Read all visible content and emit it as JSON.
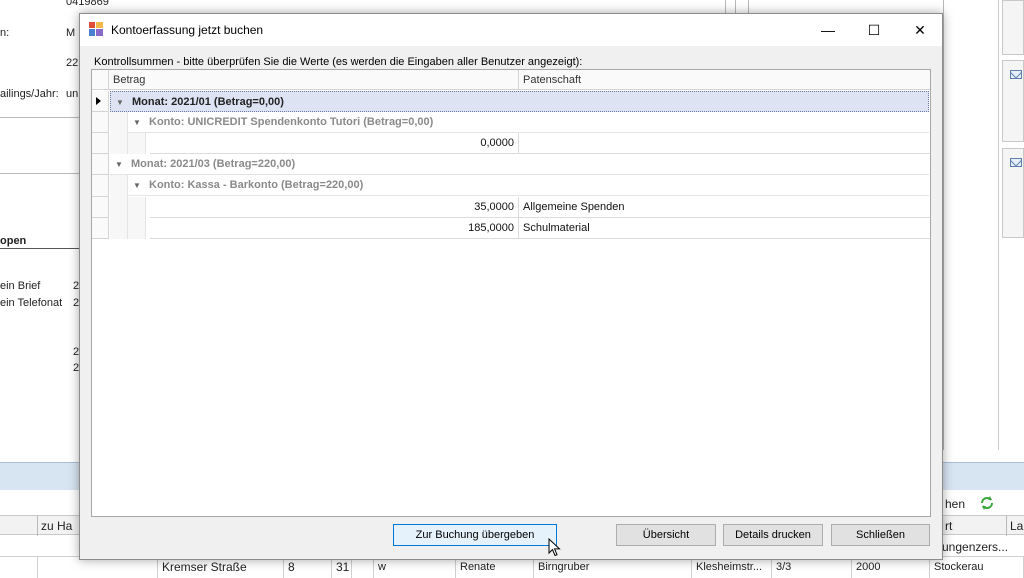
{
  "background": {
    "fields": [
      {
        "label": "",
        "value": "0419869"
      },
      {
        "label": "n:",
        "value": "M"
      },
      {
        "label": "",
        "value": "22"
      },
      {
        "label": "ailings/Jahr:",
        "value": "un"
      }
    ],
    "section_title": "open",
    "list_items": [
      {
        "label": "ein Brief",
        "value": "2"
      },
      {
        "label": "ein Telefonat",
        "value": "2"
      },
      {
        "label": "",
        "value": "2"
      },
      {
        "label": "",
        "value": "2"
      }
    ],
    "strip_right_label": "hen",
    "grid_header_left": "zu Ha",
    "grid_header_right": [
      "rt",
      "La"
    ],
    "grid_row_top_right": "ungenzers...",
    "grid_row": [
      "Kremser Straße",
      "8",
      "31",
      "w",
      "Renate",
      "Birngruber",
      "Klesheimstr...",
      "3/3",
      "2000",
      "Stockerau"
    ]
  },
  "dialog": {
    "title": "Kontoerfassung jetzt buchen",
    "window_controls": {
      "minimize": "—",
      "maximize": "☐",
      "close": "✕"
    },
    "caption": "Kontrollsummen - bitte überprüfen Sie die Werte (es werden die Eingaben aller Benutzer angezeigt):",
    "columns": [
      "Betrag",
      "Patenschaft"
    ],
    "groups": [
      {
        "month": "Monat: 2021/01 (Betrag=0,00)",
        "accounts": [
          {
            "account": "Konto: UNICREDIT Spendenkonto Tutori (Betrag=0,00)",
            "rows": [
              {
                "betrag": "0,0000",
                "patenschaft": ""
              }
            ]
          }
        ]
      },
      {
        "month": "Monat: 2021/03 (Betrag=220,00)",
        "accounts": [
          {
            "account": "Konto: Kassa - Barkonto (Betrag=220,00)",
            "rows": [
              {
                "betrag": "35,0000",
                "patenschaft": "Allgemeine Spenden"
              },
              {
                "betrag": "185,0000",
                "patenschaft": "Schulmaterial"
              }
            ]
          }
        ]
      }
    ],
    "buttons": {
      "submit": "Zur Buchung übergeben",
      "overview": "Übersicht",
      "print": "Details drucken",
      "close": "Schließen"
    }
  },
  "colors": {
    "selection": "#dde3f3",
    "dialog_bg": "#f0f0f0",
    "strip": "#d7e4f2",
    "primary_border": "#0078d7"
  }
}
